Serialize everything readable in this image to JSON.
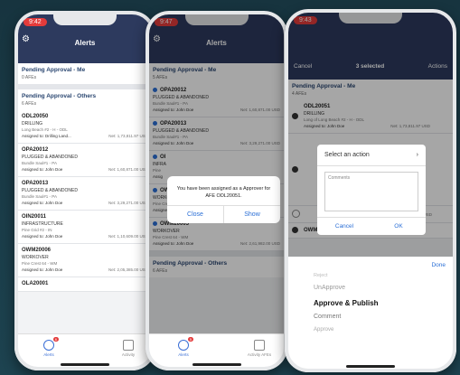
{
  "phone1": {
    "time": "9:42",
    "title": "Alerts",
    "sections": [
      {
        "title": "Pending Approval - Me",
        "count": "0 AFEs"
      },
      {
        "title": "Pending Approval - Others",
        "count": "6 AFEs"
      }
    ],
    "items": [
      {
        "code": "ODL20050",
        "status": "DRILLING",
        "loc": "Long Beach #2 - H - ODL",
        "assigned": "Assigned to: Drilling Land...",
        "net": "Net: 1,73,811.97 USD"
      },
      {
        "code": "OPA20012",
        "status": "PLUGGED & ABANDONED",
        "loc": "Bundle Saul#1 - PA",
        "assigned": "Assigned to: John Doe",
        "net": "Net: 1,60,871.00 USD"
      },
      {
        "code": "OPA20013",
        "status": "PLUGGED & ABANDONED",
        "loc": "Bundle Saul#1 - PA",
        "assigned": "Assigned to: John Doe",
        "net": "Net: 3,29,271.00 USD"
      },
      {
        "code": "OIN20011",
        "status": "INFRASTRUCTURE",
        "loc": "Pine Grid #2 - IN",
        "assigned": "Assigned to: John Doe",
        "net": "Net: 1,10,609.00 USD"
      },
      {
        "code": "OWM20006",
        "status": "WORKOVER",
        "loc": "Pine Crest 64 - WM",
        "assigned": "Assigned to: John Doe",
        "net": "Net: 2,05,385.00 USD"
      },
      {
        "code": "OLA20001",
        "status": "",
        "loc": "",
        "assigned": "",
        "net": ""
      }
    ],
    "tab_alerts": "Alerts",
    "tab_alerts_badge": "6",
    "tab_second": "Activity"
  },
  "phone2": {
    "time": "9:47",
    "title": "Alerts",
    "section_title": "Pending Approval - Me",
    "section_count": "5 AFEs",
    "items": [
      {
        "code": "OPA20012",
        "status": "PLUGGED & ABANDONED",
        "loc": "Bundle Saul#1 - PA",
        "assigned": "Assigned to: John Doe",
        "net": "Net: 1,60,871.00 USD"
      },
      {
        "code": "OPA20013",
        "status": "PLUGGED & ABANDONED",
        "loc": "Bundle Saul#1 - PA",
        "assigned": "Assigned to: John Doe",
        "net": "Net: 3,29,271.00 USD"
      },
      {
        "code": "OI",
        "status": "INFRA",
        "loc": "Pine",
        "assigned": "Assig",
        "net": ""
      },
      {
        "code": "OW",
        "status": "WORKOVER",
        "loc": "Pine Crest 64 - WM",
        "assigned": "Assigned to: John Doe",
        "net": "Net: 2,36,363.00 USD"
      },
      {
        "code": "OWM20005",
        "status": "WORKOVER",
        "loc": "Pine Crest 64 - WM",
        "assigned": "Assigned to: John Doe",
        "net": "Net: 2,61,982.00 USD"
      }
    ],
    "section2_title": "Pending Approval - Others",
    "section2_count": "6 AFEs",
    "alert_message": "You have been assigned as a Approver for AFE ODL20051.",
    "alert_close": "Close",
    "alert_show": "Show",
    "tab_alerts": "Alerts",
    "tab_alerts_badge": "5",
    "tab_second": "Activity AFEs"
  },
  "phone3": {
    "time": "9:43",
    "cancel": "Cancel",
    "selected": "3 selected",
    "actions": "Actions",
    "section_title": "Pending Approval - Me",
    "section_count": "4 AFEs",
    "items": [
      {
        "code": "ODL20051",
        "status": "DRILLING",
        "loc": "Long of Long Beach #2 - H - ODL",
        "assigned": "Assigned to: John Doe",
        "net": "Net: 1,73,811.97 USD"
      },
      {
        "code": "",
        "status": "",
        "loc": "",
        "assigned": "",
        "net": "Net: 1,10,609.00 USD"
      },
      {
        "code": "OWM20005",
        "status": "",
        "loc": "",
        "assigned": "",
        "net": ""
      }
    ],
    "dialog_select": "Select an action",
    "dialog_comments": "Comments",
    "dialog_cancel": "Cancel",
    "dialog_ok": "OK",
    "picker_done": "Done",
    "picker_options": [
      "Reject",
      "UnApprove",
      "Approve & Publish",
      "Comment",
      "Approve"
    ]
  }
}
